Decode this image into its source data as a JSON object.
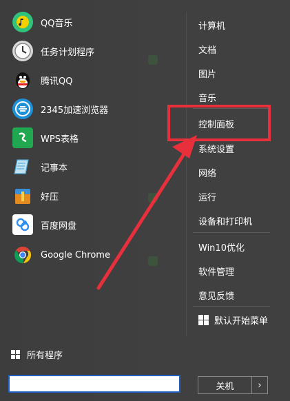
{
  "apps": [
    {
      "label": "QQ音乐",
      "icon": "qq-music-icon"
    },
    {
      "label": "任务计划程序",
      "icon": "task-scheduler-icon"
    },
    {
      "label": "腾讯QQ",
      "icon": "tencent-qq-icon"
    },
    {
      "label": "2345加速浏览器",
      "icon": "2345-browser-icon"
    },
    {
      "label": "WPS表格",
      "icon": "wps-spreadsheet-icon"
    },
    {
      "label": "记事本",
      "icon": "notepad-icon"
    },
    {
      "label": "好压",
      "icon": "haozip-icon"
    },
    {
      "label": "百度网盘",
      "icon": "baidu-netdisk-icon"
    },
    {
      "label": "Google Chrome",
      "icon": "google-chrome-icon"
    }
  ],
  "right_items": [
    "计算机",
    "文档",
    "图片",
    "音乐",
    "控制面板",
    "系统设置",
    "网络",
    "运行",
    "设备和打印机",
    "Win10优化",
    "软件管理",
    "意见反馈",
    "默认开始菜单"
  ],
  "all_programs": "所有程序",
  "search": {
    "value": "",
    "placeholder": ""
  },
  "shutdown": {
    "label": "关机",
    "arrow": "›"
  },
  "colors": {
    "highlight": "#e8303d",
    "search_border": "#1e5fbf"
  }
}
